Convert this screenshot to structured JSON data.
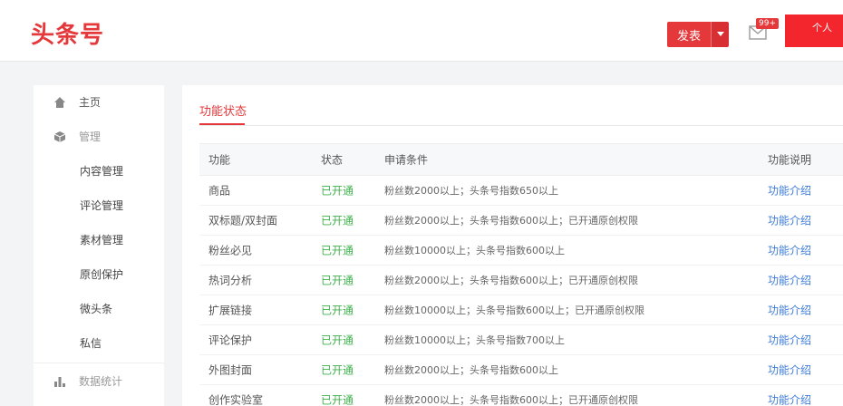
{
  "header": {
    "logo": "头条号",
    "publish_label": "发表",
    "mail_badge": "99+",
    "profile_label": "个人"
  },
  "sidebar": {
    "home": "主页",
    "manage": "管理",
    "sub_items": [
      "内容管理",
      "评论管理",
      "素材管理",
      "原创保护",
      "微头条",
      "私信"
    ],
    "stats": "数据统计"
  },
  "main": {
    "tab": "功能状态",
    "columns": [
      "功能",
      "状态",
      "申请条件",
      "功能说明"
    ],
    "rows": [
      {
        "name": "商品",
        "status": "已开通",
        "condition": "粉丝数2000以上；头条号指数650以上",
        "link": "功能介绍"
      },
      {
        "name": "双标题/双封面",
        "status": "已开通",
        "condition": "粉丝数2000以上；头条号指数600以上；已开通原创权限",
        "link": "功能介绍"
      },
      {
        "name": "粉丝必见",
        "status": "已开通",
        "condition": "粉丝数10000以上；头条号指数600以上",
        "link": "功能介绍"
      },
      {
        "name": "热词分析",
        "status": "已开通",
        "condition": "粉丝数2000以上；头条号指数600以上；已开通原创权限",
        "link": "功能介绍"
      },
      {
        "name": "扩展链接",
        "status": "已开通",
        "condition": "粉丝数10000以上；头条号指数600以上；已开通原创权限",
        "link": "功能介绍"
      },
      {
        "name": "评论保护",
        "status": "已开通",
        "condition": "粉丝数10000以上；头条号指数700以上",
        "link": "功能介绍"
      },
      {
        "name": "外图封面",
        "status": "已开通",
        "condition": "粉丝数2000以上；头条号指数600以上",
        "link": "功能介绍"
      },
      {
        "name": "创作实验室",
        "status": "已开通",
        "condition": "粉丝数2000以上；头条号指数600以上；已开通原创权限",
        "link": "功能介绍"
      }
    ]
  },
  "colors": {
    "brand": "#e5383b",
    "status_on": "#3fb24c",
    "link": "#3d7bd6"
  }
}
